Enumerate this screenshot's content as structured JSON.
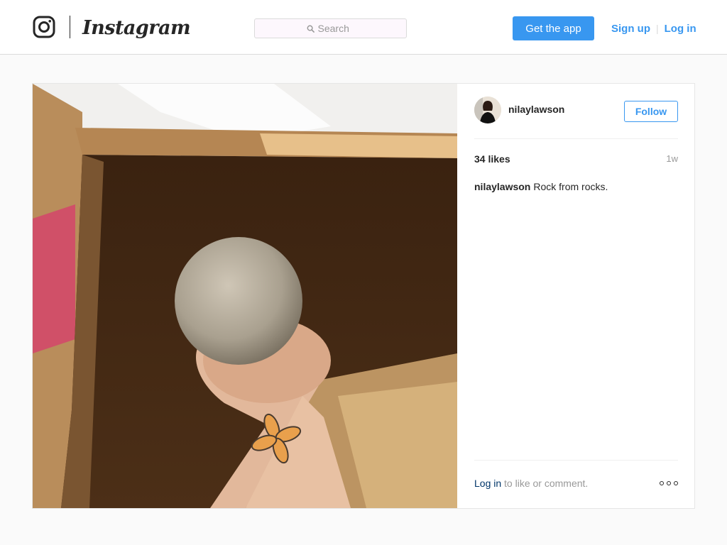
{
  "header": {
    "wordmark": "Instagram",
    "search": {
      "placeholder": "Search",
      "icon": "search-icon"
    },
    "get_app_label": "Get the app",
    "signup_label": "Sign up",
    "separator": "|",
    "login_label": "Log in"
  },
  "post": {
    "username": "nilaylawson",
    "follow_label": "Follow",
    "likes": "34 likes",
    "time": "1w",
    "caption_user": "nilaylawson",
    "caption_text": "Rock from rocks.",
    "login_link": "Log in",
    "login_suffix": " to like or comment."
  },
  "colors": {
    "accent": "#3897f0",
    "link_dark": "#003569",
    "border": "#dbdbdb",
    "background": "#fafafa"
  }
}
